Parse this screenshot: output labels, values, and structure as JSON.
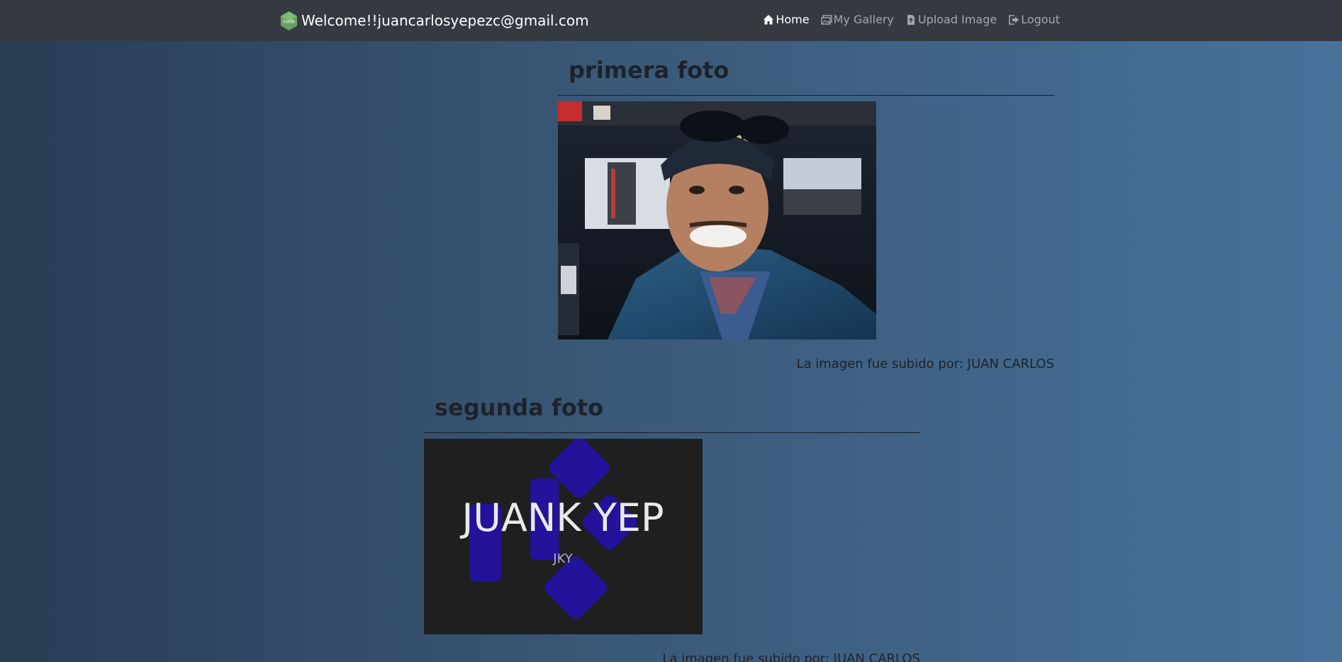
{
  "nav": {
    "brand_text": "Welcome!!juancarlosyepezc@gmail.com",
    "brand_logo_text": "node",
    "links": [
      {
        "label": "Home",
        "icon": "home-icon",
        "active": true
      },
      {
        "label": "My Gallery",
        "icon": "gallery-icon",
        "active": false
      },
      {
        "label": "Upload Image",
        "icon": "file-upload-icon",
        "active": false
      },
      {
        "label": "Logout",
        "icon": "logout-icon",
        "active": false
      }
    ]
  },
  "posts": [
    {
      "title": "primera foto",
      "caption": "La imagen fue subido por: JUAN CARLOS"
    },
    {
      "title": "segunda foto",
      "image_text": "JUANK YEP",
      "image_subtext": "JKY",
      "caption": "La imagen fue subido por: JUAN CARLOS"
    }
  ],
  "colors": {
    "navbar": "#343a40",
    "logo_blue": "#23129a",
    "node_green": "#68a063"
  }
}
